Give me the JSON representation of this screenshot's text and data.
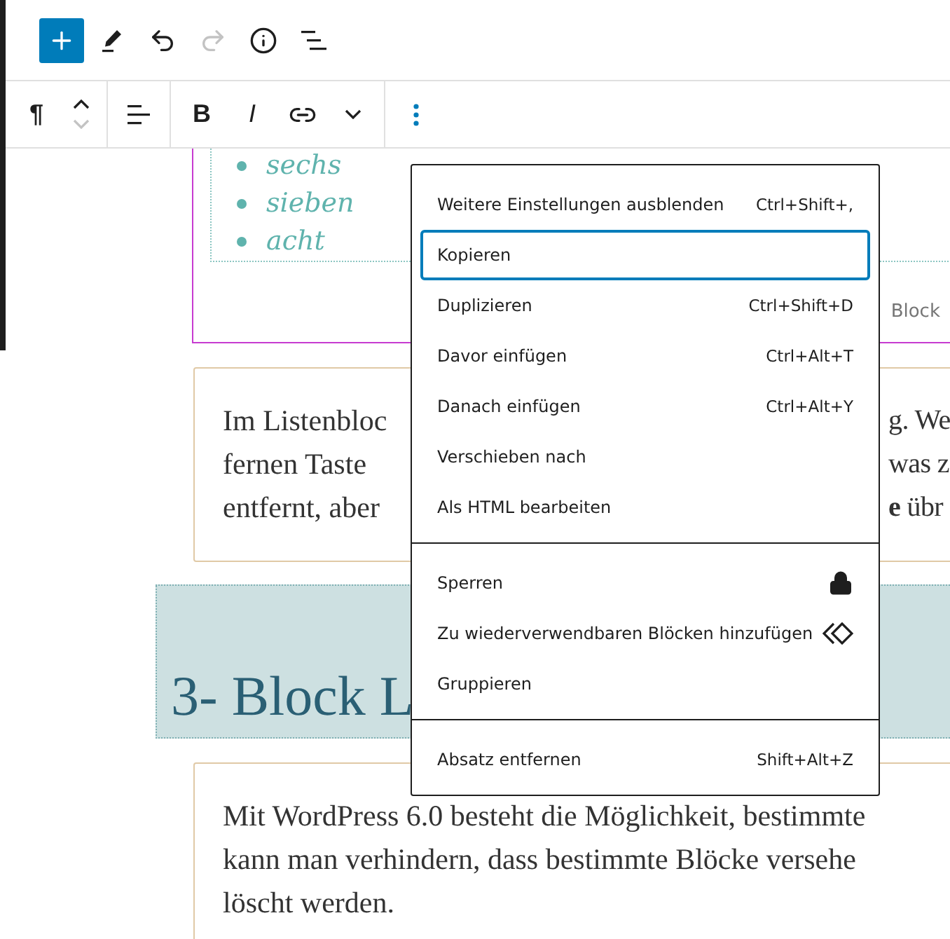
{
  "top_toolbar": {
    "tools": [
      {
        "kind": "add",
        "disabled": false
      },
      {
        "kind": "edit",
        "disabled": false
      },
      {
        "kind": "undo",
        "disabled": false
      },
      {
        "kind": "redo",
        "disabled": true
      },
      {
        "kind": "info",
        "disabled": false
      },
      {
        "kind": "outline",
        "disabled": false
      }
    ]
  },
  "block_toolbar": {
    "paragraph_symbol": "¶",
    "move": [
      {
        "kind": "up",
        "disabled": false
      },
      {
        "kind": "down",
        "disabled": true
      }
    ],
    "bold": "B",
    "italic": "I"
  },
  "list_block": {
    "items": [
      "sechs",
      "sieben",
      "acht"
    ],
    "label": "Block"
  },
  "paragraph_1": {
    "lines": [
      {
        "left": "Im Listenbloc",
        "right": "g. We"
      },
      {
        "left": "fernen Taste",
        "right": "was z"
      },
      {
        "left": "entfernt, aber",
        "right": "**e** übr"
      }
    ]
  },
  "heading": "3- Block L",
  "paragraph_2": {
    "lines": [
      "Mit WordPress 6.0 besteht die Möglichkeit, bestimmte",
      "kann man verhindern, dass bestimmte Blöcke versehe",
      "löscht werden."
    ]
  },
  "menu": {
    "sections": [
      [
        {
          "kind": "shortcut",
          "label": "Weitere Einstellungen ausblenden",
          "shortcut": "Ctrl+Shift+,",
          "selected": false
        },
        {
          "kind": "plain",
          "label": "Kopieren",
          "selected": true
        },
        {
          "kind": "shortcut",
          "label": "Duplizieren",
          "shortcut": "Ctrl+Shift+D",
          "selected": false
        },
        {
          "kind": "shortcut",
          "label": "Davor einfügen",
          "shortcut": "Ctrl+Alt+T",
          "selected": false
        },
        {
          "kind": "shortcut",
          "label": "Danach einfügen",
          "shortcut": "Ctrl+Alt+Y",
          "selected": false
        },
        {
          "kind": "plain",
          "label": "Verschieben nach",
          "selected": false
        },
        {
          "kind": "plain",
          "label": "Als HTML bearbeiten",
          "selected": false
        }
      ],
      [
        {
          "kind": "lock",
          "label": "Sperren",
          "selected": false
        },
        {
          "kind": "reusable",
          "label": "Zu wiederverwendbaren Blöcken hinzufügen",
          "selected": false
        },
        {
          "kind": "plain",
          "label": "Gruppieren",
          "selected": false
        }
      ],
      [
        {
          "kind": "shortcut",
          "label": "Absatz entfernen",
          "shortcut": "Shift+Alt+Z",
          "selected": false
        }
      ]
    ]
  }
}
